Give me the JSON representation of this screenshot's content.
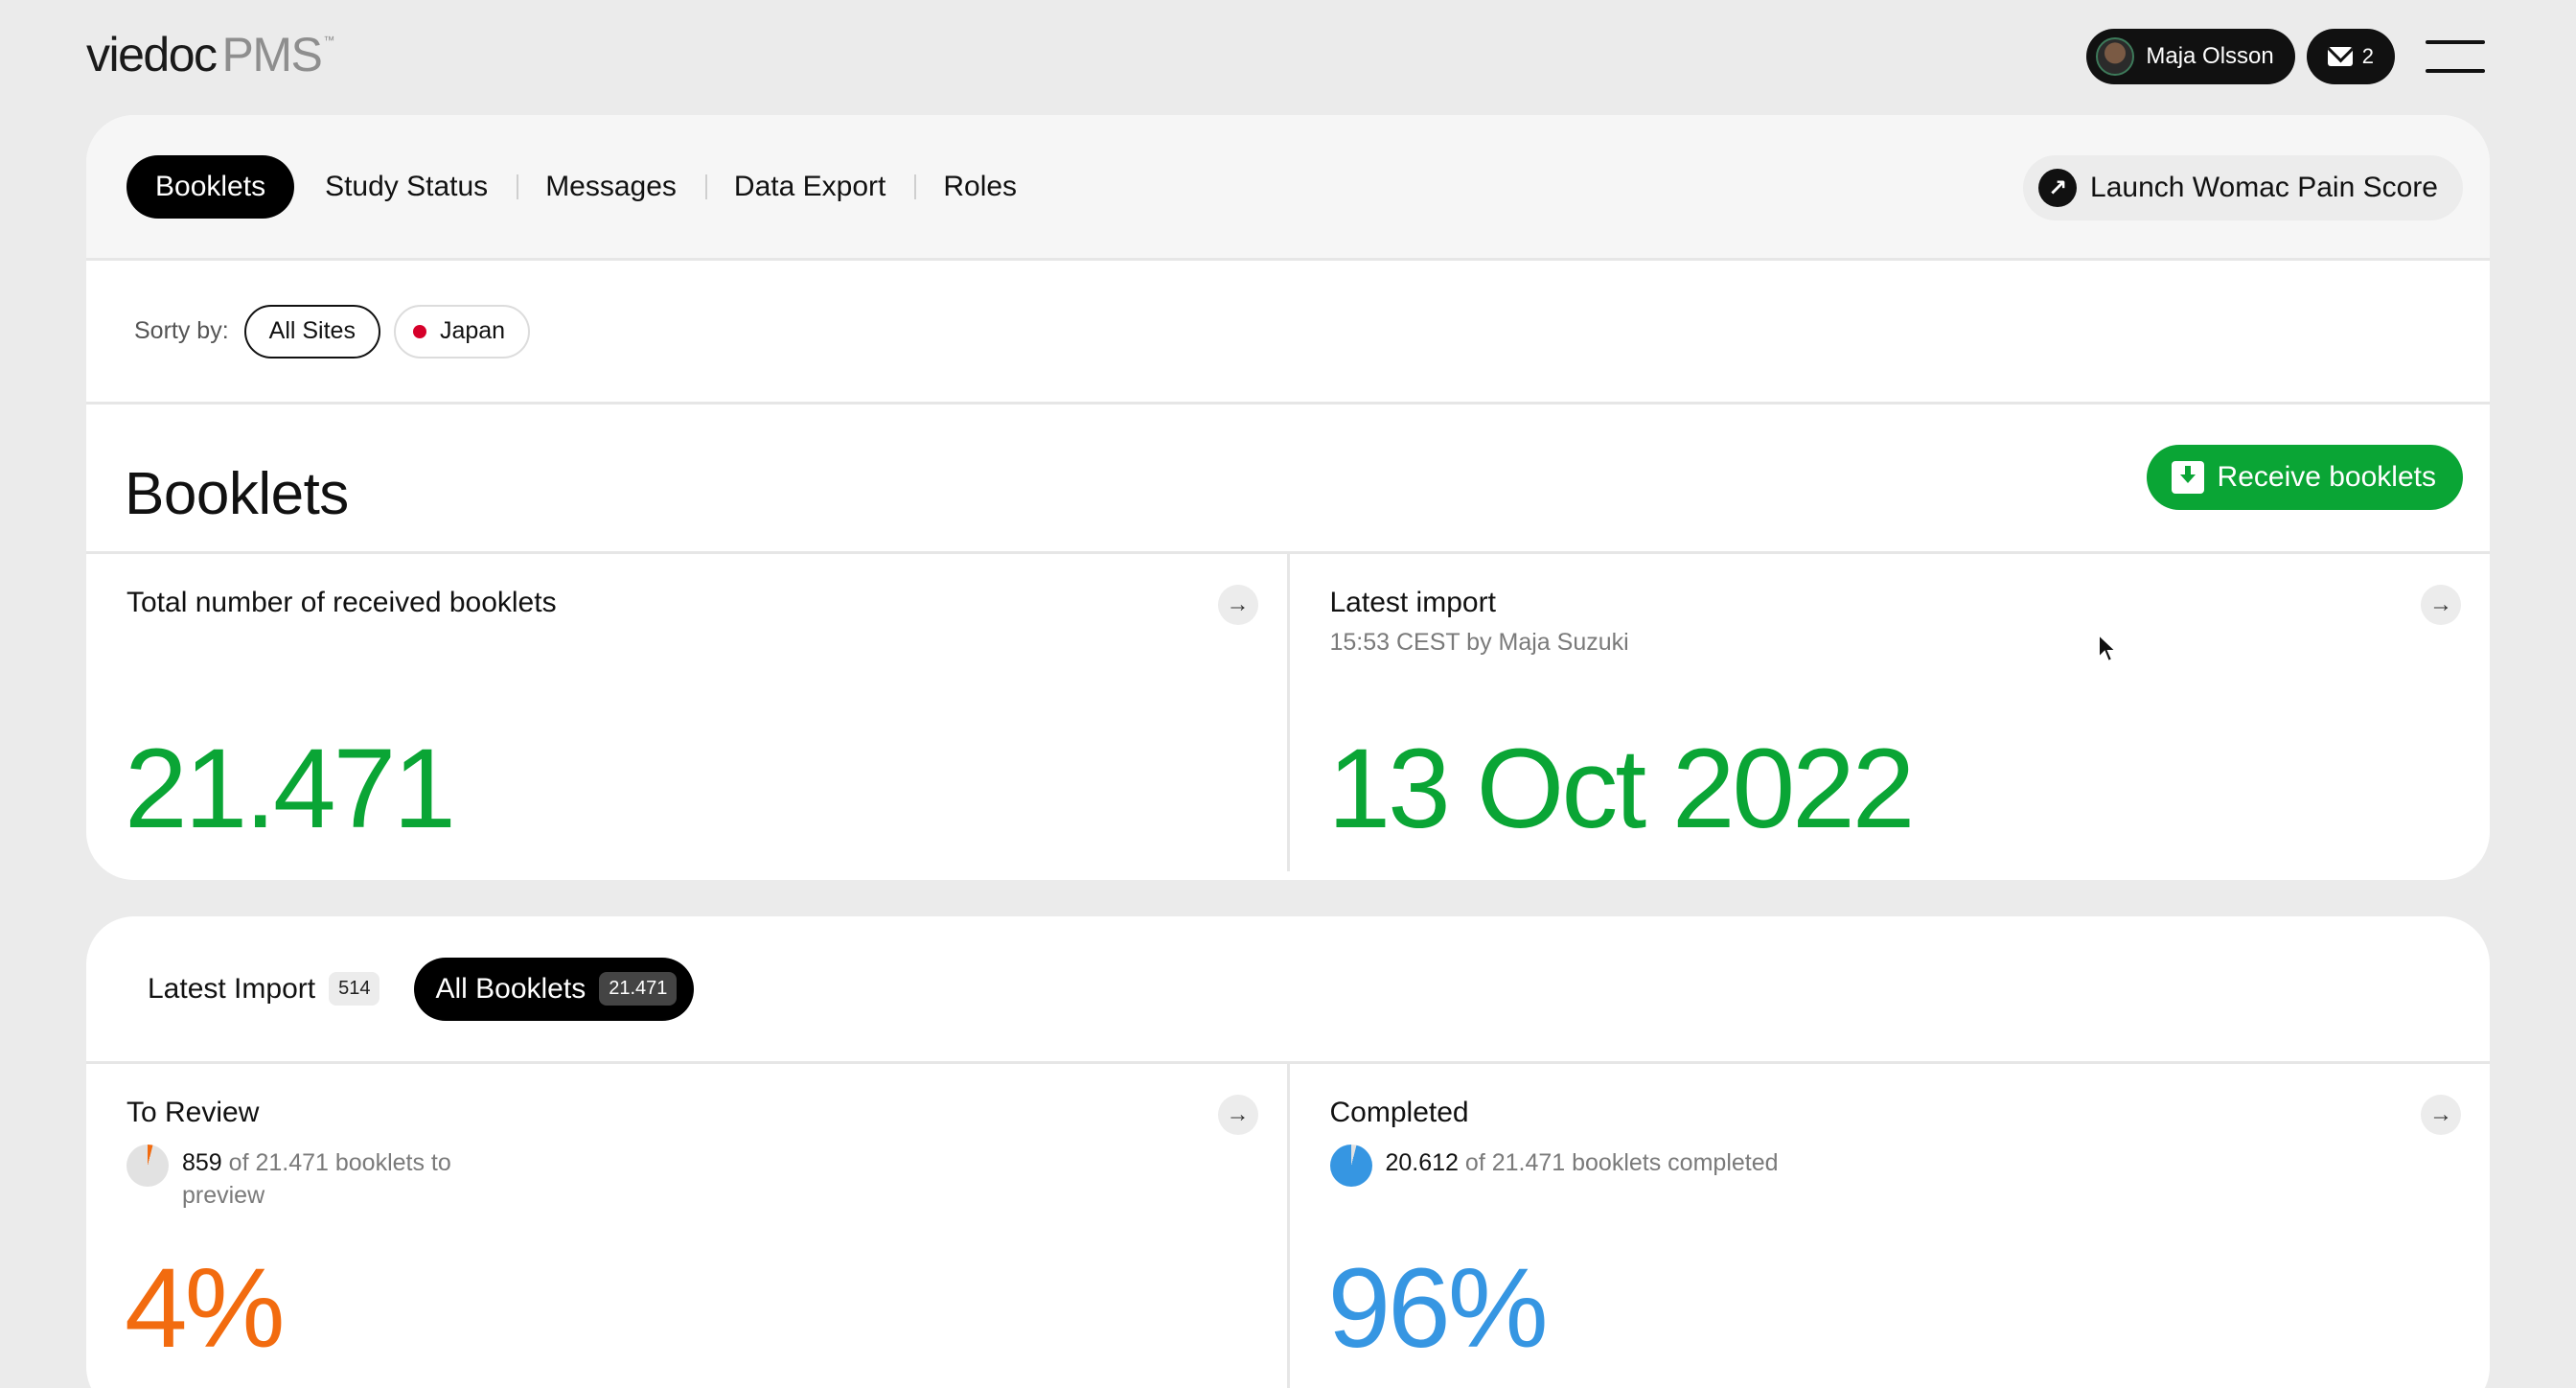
{
  "app": {
    "brand": "viedoc",
    "product": "PMS",
    "tm": "™"
  },
  "header": {
    "user_name": "Maja Olsson",
    "mail_count": "2"
  },
  "nav": {
    "tabs": [
      "Booklets",
      "Study Status",
      "Messages",
      "Data Export",
      "Roles"
    ],
    "active_tab": "Booklets",
    "launch_label": "Launch Womac Pain Score"
  },
  "sort": {
    "label": "Sorty by:",
    "options": [
      "All Sites",
      "Japan"
    ],
    "selected": "All Sites"
  },
  "booklets": {
    "title": "Booklets",
    "receive_label": "Receive booklets",
    "total": {
      "title": "Total number of received booklets",
      "value": "21.471"
    },
    "latest_import": {
      "title": "Latest import",
      "subtitle": "15:53 CEST by Maja Suzuki",
      "value": "13 Oct 2022"
    }
  },
  "filters": {
    "latest_import": {
      "label": "Latest Import",
      "count": "514"
    },
    "all_booklets": {
      "label": "All Booklets",
      "count": "21.471"
    },
    "active": "All Booklets"
  },
  "review": {
    "title": "To Review",
    "count": "859",
    "text": " of 21.471 booklets to preview",
    "percent": "4%",
    "fraction": 0.04
  },
  "completed": {
    "title": "Completed",
    "count": "20.612",
    "text": " of 21.471 booklets completed",
    "percent": "96%",
    "fraction": 0.96
  },
  "colors": {
    "green": "#0aa535",
    "orange": "#f26b0f",
    "blue": "#3696e2",
    "dark": "#111111"
  }
}
